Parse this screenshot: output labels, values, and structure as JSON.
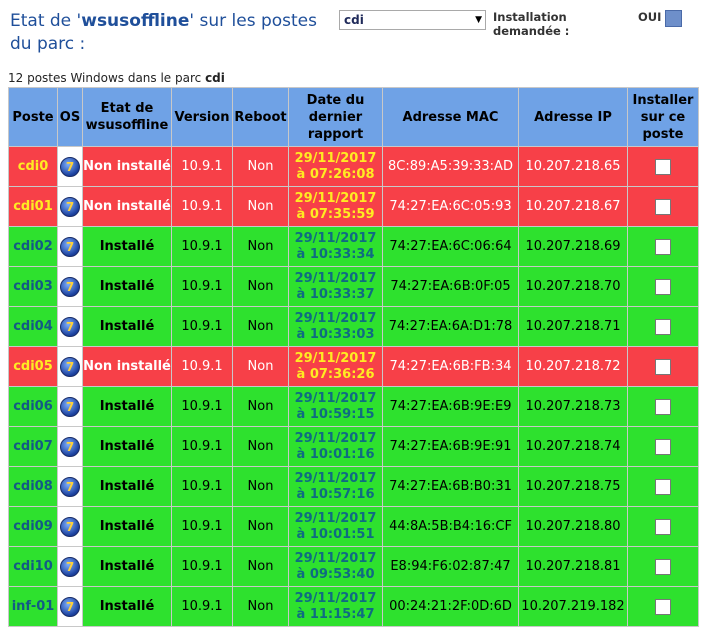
{
  "header": {
    "title_prefix": "Etat de '",
    "title_name": "wsusoffline",
    "title_suffix": "' sur les postes du parc :",
    "park_select_value": "cdi",
    "install_label": "Installation demandée :",
    "oui_label": "OUI"
  },
  "summary": {
    "text": "12 postes Windows dans le parc ",
    "park": "cdi"
  },
  "table": {
    "headers": [
      "Poste",
      "OS",
      "Etat de wsusoffline",
      "Version",
      "Reboot",
      "Date du dernier rapport",
      "Adresse MAC",
      "Adresse IP",
      "Installer sur ce poste"
    ],
    "rows": [
      {
        "poste": "cdi0",
        "status": "red",
        "etat": "Non installé",
        "version": "10.9.1",
        "reboot": "Non",
        "date1": "29/11/2017",
        "date2": "à 07:26:08",
        "mac": "8C:89:A5:39:33:AD",
        "ip": "10.207.218.65"
      },
      {
        "poste": "cdi01",
        "status": "red",
        "etat": "Non installé",
        "version": "10.9.1",
        "reboot": "Non",
        "date1": "29/11/2017",
        "date2": "à 07:35:59",
        "mac": "74:27:EA:6C:05:93",
        "ip": "10.207.218.67"
      },
      {
        "poste": "cdi02",
        "status": "green",
        "etat": "Installé",
        "version": "10.9.1",
        "reboot": "Non",
        "date1": "29/11/2017",
        "date2": "à 10:33:34",
        "mac": "74:27:EA:6C:06:64",
        "ip": "10.207.218.69"
      },
      {
        "poste": "cdi03",
        "status": "green",
        "etat": "Installé",
        "version": "10.9.1",
        "reboot": "Non",
        "date1": "29/11/2017",
        "date2": "à 10:33:37",
        "mac": "74:27:EA:6B:0F:05",
        "ip": "10.207.218.70"
      },
      {
        "poste": "cdi04",
        "status": "green",
        "etat": "Installé",
        "version": "10.9.1",
        "reboot": "Non",
        "date1": "29/11/2017",
        "date2": "à 10:33:03",
        "mac": "74:27:EA:6A:D1:78",
        "ip": "10.207.218.71"
      },
      {
        "poste": "cdi05",
        "status": "red",
        "etat": "Non installé",
        "version": "10.9.1",
        "reboot": "Non",
        "date1": "29/11/2017",
        "date2": "à 07:36:26",
        "mac": "74:27:EA:6B:FB:34",
        "ip": "10.207.218.72"
      },
      {
        "poste": "cdi06",
        "status": "green",
        "etat": "Installé",
        "version": "10.9.1",
        "reboot": "Non",
        "date1": "29/11/2017",
        "date2": "à 10:59:15",
        "mac": "74:27:EA:6B:9E:E9",
        "ip": "10.207.218.73"
      },
      {
        "poste": "cdi07",
        "status": "green",
        "etat": "Installé",
        "version": "10.9.1",
        "reboot": "Non",
        "date1": "29/11/2017",
        "date2": "à 10:01:16",
        "mac": "74:27:EA:6B:9E:91",
        "ip": "10.207.218.74"
      },
      {
        "poste": "cdi08",
        "status": "green",
        "etat": "Installé",
        "version": "10.9.1",
        "reboot": "Non",
        "date1": "29/11/2017",
        "date2": "à 10:57:16",
        "mac": "74:27:EA:6B:B0:31",
        "ip": "10.207.218.75"
      },
      {
        "poste": "cdi09",
        "status": "green",
        "etat": "Installé",
        "version": "10.9.1",
        "reboot": "Non",
        "date1": "29/11/2017",
        "date2": "à 10:01:51",
        "mac": "44:8A:5B:B4:16:CF",
        "ip": "10.207.218.80"
      },
      {
        "poste": "cdi10",
        "status": "green",
        "etat": "Installé",
        "version": "10.9.1",
        "reboot": "Non",
        "date1": "29/11/2017",
        "date2": "à 09:53:40",
        "mac": "E8:94:F6:02:87:47",
        "ip": "10.207.218.81"
      },
      {
        "poste": "inf-01",
        "status": "green",
        "etat": "Installé",
        "version": "10.9.1",
        "reboot": "Non",
        "date1": "29/11/2017",
        "date2": "à 11:15:47",
        "mac": "00:24:21:2F:0D:6D",
        "ip": "10.207.219.182"
      }
    ]
  },
  "colors": {
    "header_bg": "#6fa2e6",
    "row_red": "#f74048",
    "row_green": "#2ee12e",
    "title_blue": "#1f4f9a"
  },
  "icons": {
    "os": "windows-7-icon",
    "select_arrow": "chevron-down-icon",
    "checkbox": "checkbox-icon"
  }
}
